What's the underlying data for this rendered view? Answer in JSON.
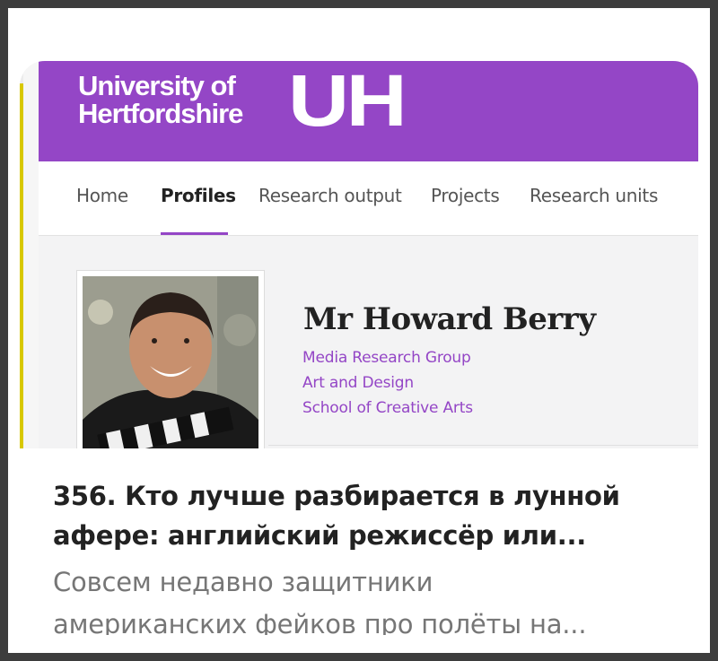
{
  "site": {
    "logo": {
      "line1": "University of",
      "line2": "Hertfordshire",
      "mark": "UH"
    },
    "nav": [
      {
        "label": "Home",
        "active": false
      },
      {
        "label": "Profiles",
        "active": true
      },
      {
        "label": "Research output",
        "active": false
      },
      {
        "label": "Projects",
        "active": false
      },
      {
        "label": "Research units",
        "active": false
      }
    ],
    "profile": {
      "name": "Mr Howard Berry",
      "affiliations": [
        "Media Research Group",
        "Art and Design",
        "School of Creative Arts"
      ]
    },
    "colors": {
      "brand": "#9446c6"
    }
  },
  "card": {
    "title_line1": "356. Кто лучше разбирается в лунной",
    "title_line2": "афере: английский режиссёр или...",
    "subtitle_line1": "Совсем недавно защитники",
    "subtitle_line2": "американских фейков про полёты на..."
  }
}
